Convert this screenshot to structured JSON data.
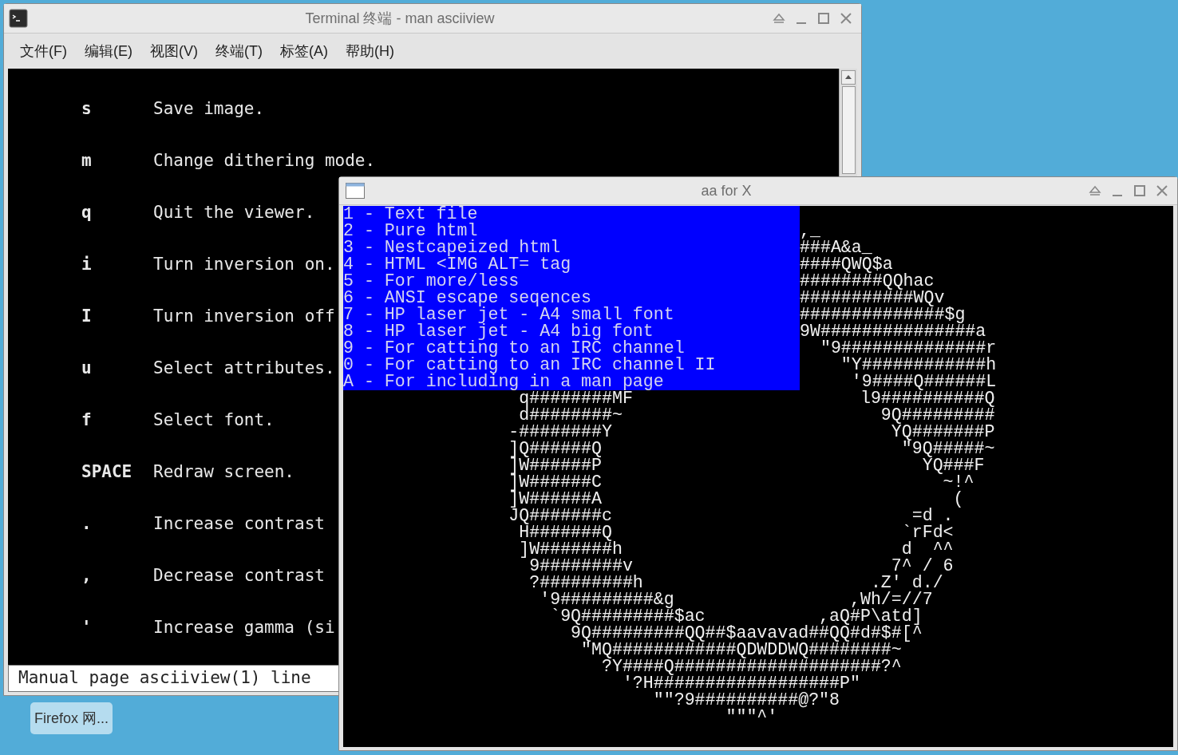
{
  "terminal": {
    "title": "Terminal 终端 - man asciiview",
    "menu": [
      "文件(F)",
      "编辑(E)",
      "视图(V)",
      "终端(T)",
      "标签(A)",
      "帮助(H)"
    ],
    "rows": [
      {
        "key": "s",
        "text": "Save image."
      },
      {
        "key": "m",
        "text": "Change dithering mode."
      },
      {
        "key": "q",
        "text": "Quit the viewer."
      },
      {
        "key": "i",
        "text": "Turn inversion on."
      },
      {
        "key": "I",
        "text": "Turn inversion off"
      },
      {
        "key": "u",
        "text": "Select attributes."
      },
      {
        "key": "f",
        "text": "Select font."
      },
      {
        "key": "SPACE",
        "text": "Redraw screen."
      },
      {
        "key": ".",
        "text": "Increase contrast"
      },
      {
        "key": ",",
        "text": "Decrease contrast"
      },
      {
        "key": "'",
        "text": "Increase gamma (si"
      }
    ],
    "status": "Manual page asciiview(1) line"
  },
  "viewer": {
    "title": "aa for X",
    "menu": [
      "1 - Text file",
      "2 - Pure html",
      "3 - Nestcapeized html",
      "4 - HTML <IMG ALT= tag",
      "5 - For more/less",
      "6 - ANSI escape seqences",
      "7 - HP laser jet - A4 small font",
      "8 - HP laser jet - A4 big font",
      "9 - For catting to an IRC channel",
      "0 - For catting to an IRC channel II",
      "A - For including in a man page"
    ],
    "art_top": [
      ",_",
      "###A&a_",
      "####QWQ$a",
      "########QQhac",
      "###########WQv",
      "##############$g",
      "9W###############a",
      "  \"9##############r",
      "    \"Y############h",
      "     '9####Q######L"
    ],
    "art_bottom": [
      "                 q########MF                      l9##########Q",
      "                 d########~                         9Q#########",
      "                -########Y                           YQ#######P",
      "                ]Q######Q                             \"9Q#####~",
      "                ]W######P                               YQ###F",
      "                ]W######C                                 ~!^",
      "                ]W######A                                  (",
      "                JQ#######c                             =d .",
      "                 H#######Q                            `rFd<",
      "                 ]W#######h                           d  ^^",
      "                  9########v                         7^ / 6",
      "                  ?#########h                      .Z' d./",
      "                   '9#########&g                 ,Wh/=//7",
      "                    `9Q#########$ac           ,aQ#P\\atd]",
      "                      9Q#########QQ##$aavavad##QQ#d#$#[^",
      "                       \"MQ############QDWDDWQ########~",
      "                         ?Y####Q####################?^",
      "                           '?H##################P\"",
      "                              \"\"?9##########@?\"8",
      "                                     \"\"\"^'"
    ]
  },
  "taskbar": [
    {
      "label": "Firefox 网..."
    }
  ]
}
